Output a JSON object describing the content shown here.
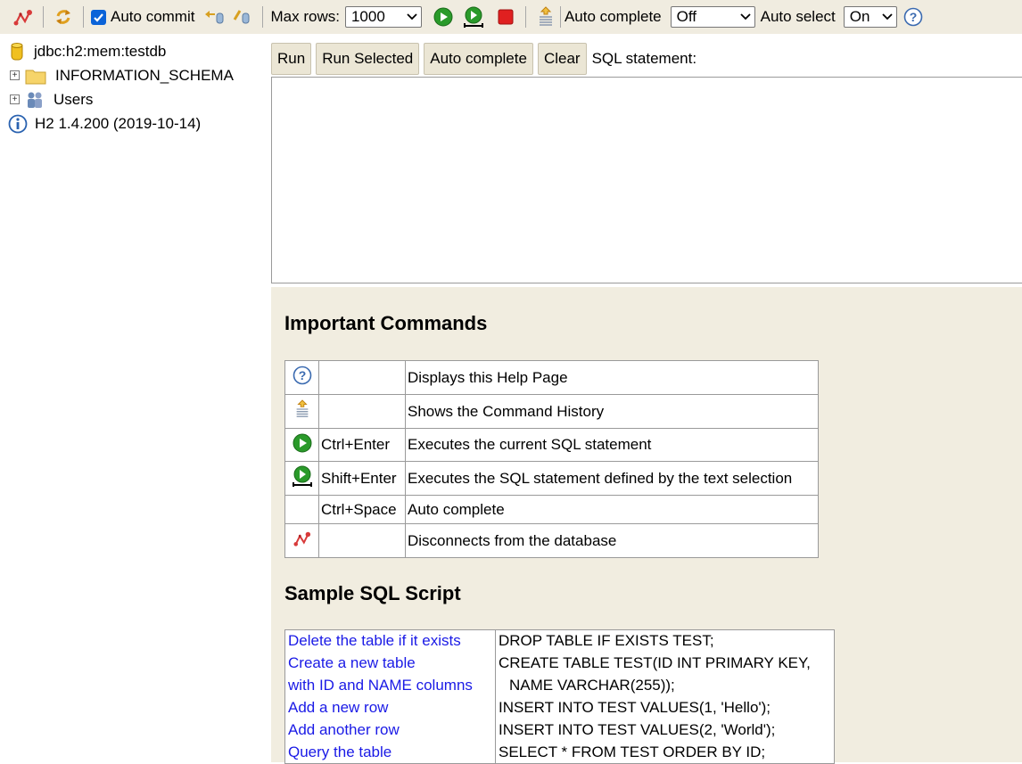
{
  "toolbar": {
    "auto_commit_label": "Auto commit",
    "max_rows_label": "Max rows:",
    "max_rows_value": "1000",
    "auto_complete_label": "Auto complete",
    "auto_complete_value": "Off",
    "auto_select_label": "Auto select",
    "auto_select_value": "On"
  },
  "tree": {
    "connection": "jdbc:h2:mem:testdb",
    "schema": "INFORMATION_SCHEMA",
    "users": "Users",
    "version": "H2 1.4.200 (2019-10-14)"
  },
  "query": {
    "run": "Run",
    "run_selected": "Run Selected",
    "auto_complete": "Auto complete",
    "clear": "Clear",
    "sql_label": "SQL statement:"
  },
  "help": {
    "important_title": "Important Commands",
    "commands": [
      {
        "icon": "help-icon",
        "key": "",
        "desc": "Displays this Help Page"
      },
      {
        "icon": "history-icon",
        "key": "",
        "desc": "Shows the Command History"
      },
      {
        "icon": "run-icon",
        "key": "Ctrl+Enter",
        "desc": "Executes the current SQL statement"
      },
      {
        "icon": "run-selected-icon",
        "key": "Shift+Enter",
        "desc": "Executes the SQL statement defined by the text selection"
      },
      {
        "icon": "",
        "key": "Ctrl+Space",
        "desc": "Auto complete"
      },
      {
        "icon": "disconnect-icon",
        "key": "",
        "desc": "Disconnects from the database"
      }
    ],
    "sample_title": "Sample SQL Script",
    "script": [
      {
        "label": "Delete the table if it exists",
        "sql": "DROP TABLE IF EXISTS TEST;"
      },
      {
        "label": "Create a new table",
        "sql": "CREATE TABLE TEST(ID INT PRIMARY KEY,"
      },
      {
        "label": "with ID and NAME columns",
        "sql": "NAME VARCHAR(255));"
      },
      {
        "label": "Add a new row",
        "sql": "INSERT INTO TEST VALUES(1, 'Hello');"
      },
      {
        "label": "Add another row",
        "sql": "INSERT INTO TEST VALUES(2, 'World');"
      },
      {
        "label": "Query the table",
        "sql": "SELECT * FROM TEST ORDER BY ID;"
      }
    ]
  },
  "colors": {
    "toolbar_bg": "#f0ece0",
    "help_bg": "#f1ede0",
    "link": "#1a1ae6",
    "run_green": "#2a9a2a",
    "stop_red": "#e02020"
  }
}
